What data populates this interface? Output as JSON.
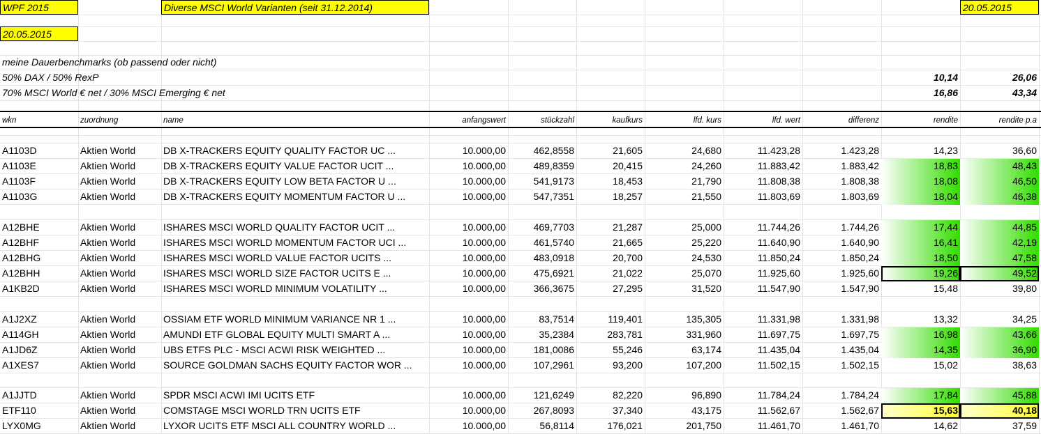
{
  "top": {
    "title": "WPF 2015",
    "subtitle": "Diverse MSCI World Varianten (seit 31.12.2014)",
    "date_right": "20.05.2015",
    "date_left": "20.05.2015"
  },
  "benchmarks": {
    "heading": "meine Dauerbenchmarks (ob passend oder nicht)",
    "rows": [
      {
        "label": "50% DAX / 50% RexP",
        "rendite": "10,14",
        "rendite_pa": "26,06"
      },
      {
        "label": "70% MSCI World € net / 30% MSCI Emerging € net",
        "rendite": "16,86",
        "rendite_pa": "43,34"
      }
    ]
  },
  "headers": {
    "wkn": "wkn",
    "zuordnung": "zuordnung",
    "name": "name",
    "anfangswert": "anfangswert",
    "stueckzahl": "stückzahl",
    "kaufkurs": "kaufkurs",
    "lfd_kurs": "lfd. kurs",
    "lfd_wert": "lfd. wert",
    "differenz": "differenz",
    "rendite": "rendite",
    "rendite_pa": "rendite p.a"
  },
  "rows": [
    {
      "wkn": "A1103D",
      "zuordnung": "Aktien World",
      "name": "DB X-TRACKERS EQUITY QUALITY FACTOR UC ...",
      "anfangswert": "10.000,00",
      "stueckzahl": "462,8558",
      "kaufkurs": "21,605",
      "lfd_kurs": "24,680",
      "lfd_wert": "11.423,28",
      "differenz": "1.423,28",
      "rendite": "14,23",
      "rendite_pa": "36,60",
      "highlight": "none"
    },
    {
      "wkn": "A1103E",
      "zuordnung": "Aktien World",
      "name": "DB X-TRACKERS EQUITY VALUE FACTOR UCIT ...",
      "anfangswert": "10.000,00",
      "stueckzahl": "489,8359",
      "kaufkurs": "20,415",
      "lfd_kurs": "24,260",
      "lfd_wert": "11.883,42",
      "differenz": "1.883,42",
      "rendite": "18,83",
      "rendite_pa": "48,43",
      "highlight": "green"
    },
    {
      "wkn": "A1103F",
      "zuordnung": "Aktien World",
      "name": "DB X-TRACKERS EQUITY LOW BETA FACTOR U ...",
      "anfangswert": "10.000,00",
      "stueckzahl": "541,9173",
      "kaufkurs": "18,453",
      "lfd_kurs": "21,790",
      "lfd_wert": "11.808,38",
      "differenz": "1.808,38",
      "rendite": "18,08",
      "rendite_pa": "46,50",
      "highlight": "green"
    },
    {
      "wkn": "A1103G",
      "zuordnung": "Aktien World",
      "name": "DB X-TRACKERS EQUITY MOMENTUM FACTOR U ...",
      "anfangswert": "10.000,00",
      "stueckzahl": "547,7351",
      "kaufkurs": "18,257",
      "lfd_kurs": "21,550",
      "lfd_wert": "11.803,69",
      "differenz": "1.803,69",
      "rendite": "18,04",
      "rendite_pa": "46,38",
      "highlight": "green"
    },
    {
      "wkn": "A12BHE",
      "zuordnung": "Aktien World",
      "name": "ISHARES MSCI WORLD QUALITY FACTOR UCIT ...",
      "anfangswert": "10.000,00",
      "stueckzahl": "469,7703",
      "kaufkurs": "21,287",
      "lfd_kurs": "25,000",
      "lfd_wert": "11.744,26",
      "differenz": "1.744,26",
      "rendite": "17,44",
      "rendite_pa": "44,85",
      "highlight": "green"
    },
    {
      "wkn": "A12BHF",
      "zuordnung": "Aktien World",
      "name": "ISHARES MSCI WORLD MOMENTUM FACTOR UCI ...",
      "anfangswert": "10.000,00",
      "stueckzahl": "461,5740",
      "kaufkurs": "21,665",
      "lfd_kurs": "25,220",
      "lfd_wert": "11.640,90",
      "differenz": "1.640,90",
      "rendite": "16,41",
      "rendite_pa": "42,19",
      "highlight": "green"
    },
    {
      "wkn": "A12BHG",
      "zuordnung": "Aktien World",
      "name": "ISHARES MSCI WORLD VALUE FACTOR UCITS ...",
      "anfangswert": "10.000,00",
      "stueckzahl": "483,0918",
      "kaufkurs": "20,700",
      "lfd_kurs": "24,530",
      "lfd_wert": "11.850,24",
      "differenz": "1.850,24",
      "rendite": "18,50",
      "rendite_pa": "47,58",
      "highlight": "green"
    },
    {
      "wkn": "A12BHH",
      "zuordnung": "Aktien World",
      "name": "ISHARES MSCI WORLD SIZE FACTOR UCITS E ...",
      "anfangswert": "10.000,00",
      "stueckzahl": "475,6921",
      "kaufkurs": "21,022",
      "lfd_kurs": "25,070",
      "lfd_wert": "11.925,60",
      "differenz": "1.925,60",
      "rendite": "19,26",
      "rendite_pa": "49,52",
      "highlight": "green-box"
    },
    {
      "wkn": "A1KB2D",
      "zuordnung": "Aktien World",
      "name": "ISHARES MSCI WORLD MINIMUM VOLATILITY ...",
      "anfangswert": "10.000,00",
      "stueckzahl": "366,3675",
      "kaufkurs": "27,295",
      "lfd_kurs": "31,520",
      "lfd_wert": "11.547,90",
      "differenz": "1.547,90",
      "rendite": "15,48",
      "rendite_pa": "39,80",
      "highlight": "none"
    },
    {
      "wkn": "A1J2XZ",
      "zuordnung": "Aktien World",
      "name": "OSSIAM ETF WORLD MINIMUM VARIANCE NR 1 ...",
      "anfangswert": "10.000,00",
      "stueckzahl": "83,7514",
      "kaufkurs": "119,401",
      "lfd_kurs": "135,305",
      "lfd_wert": "11.331,98",
      "differenz": "1.331,98",
      "rendite": "13,32",
      "rendite_pa": "34,25",
      "highlight": "none"
    },
    {
      "wkn": "A114GH",
      "zuordnung": "Aktien World",
      "name": "AMUNDI ETF GLOBAL EQUITY MULTI SMART A ...",
      "anfangswert": "10.000,00",
      "stueckzahl": "35,2384",
      "kaufkurs": "283,781",
      "lfd_kurs": "331,960",
      "lfd_wert": "11.697,75",
      "differenz": "1.697,75",
      "rendite": "16,98",
      "rendite_pa": "43,66",
      "highlight": "green"
    },
    {
      "wkn": "A1JD6Z",
      "zuordnung": "Aktien World",
      "name": "UBS ETFS PLC - MSCI ACWI RISK WEIGHTED ...",
      "anfangswert": "10.000,00",
      "stueckzahl": "181,0086",
      "kaufkurs": "55,246",
      "lfd_kurs": "63,174",
      "lfd_wert": "11.435,04",
      "differenz": "1.435,04",
      "rendite": "14,35",
      "rendite_pa": "36,90",
      "highlight": "green"
    },
    {
      "wkn": "A1XES7",
      "zuordnung": "Aktien World",
      "name": "SOURCE GOLDMAN SACHS EQUITY FACTOR WOR ...",
      "anfangswert": "10.000,00",
      "stueckzahl": "107,2961",
      "kaufkurs": "93,200",
      "lfd_kurs": "107,200",
      "lfd_wert": "11.502,15",
      "differenz": "1.502,15",
      "rendite": "15,02",
      "rendite_pa": "38,63",
      "highlight": "none"
    },
    {
      "wkn": "A1JJTD",
      "zuordnung": "Aktien World",
      "name": "SPDR MSCI ACWI IMI UCITS ETF",
      "anfangswert": "10.000,00",
      "stueckzahl": "121,6249",
      "kaufkurs": "82,220",
      "lfd_kurs": "96,890",
      "lfd_wert": "11.784,24",
      "differenz": "1.784,24",
      "rendite": "17,84",
      "rendite_pa": "45,88",
      "highlight": "green"
    },
    {
      "wkn": "ETF110",
      "zuordnung": "Aktien World",
      "name": "COMSTAGE MSCI WORLD TRN UCITS ETF",
      "anfangswert": "10.000,00",
      "stueckzahl": "267,8093",
      "kaufkurs": "37,340",
      "lfd_kurs": "43,175",
      "lfd_wert": "11.562,67",
      "differenz": "1.562,67",
      "rendite": "15,63",
      "rendite_pa": "40,18",
      "highlight": "yellow-box"
    },
    {
      "wkn": "LYX0MG",
      "zuordnung": "Aktien World",
      "name": "LYXOR UCITS ETF MSCI ALL COUNTRY WORLD ...",
      "anfangswert": "10.000,00",
      "stueckzahl": "56,8114",
      "kaufkurs": "176,021",
      "lfd_kurs": "201,750",
      "lfd_wert": "11.461,70",
      "differenz": "1.461,70",
      "rendite": "14,62",
      "rendite_pa": "37,59",
      "highlight": "none"
    }
  ],
  "colors": {
    "green": "#33dd00",
    "yellow": "#ffff33",
    "grid": "#e3e3e3"
  }
}
